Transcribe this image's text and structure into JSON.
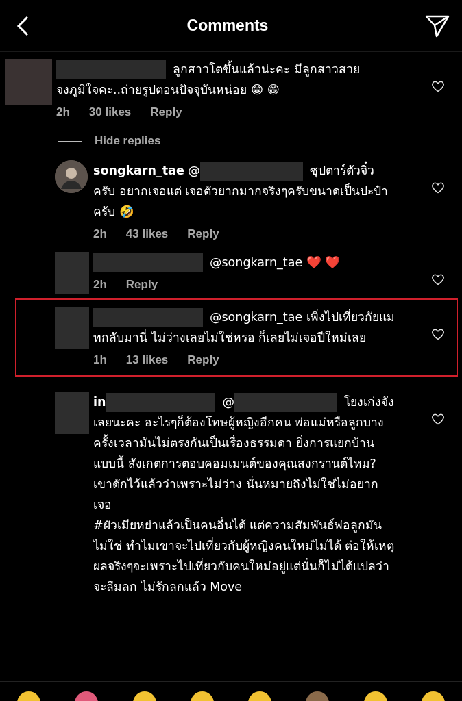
{
  "header": {
    "title": "Comments"
  },
  "comments": [
    {
      "kind": "comment",
      "text": "ลูกสาวโตขึ้นแล้วน่ะคะ มีลูกสาวสวยจงภูมิใจคะ..ถ่ายรูปตอนปัจจุบันหน่อย 😁 😁",
      "time": "2h",
      "likes": "30 likes",
      "reply": "Reply",
      "highlighted": false
    },
    {
      "kind": "toggle",
      "label": "Hide replies"
    },
    {
      "kind": "reply",
      "username": "songkarn_tae",
      "mention": "@",
      "text": "ซุปตาร์ตัวจิ๋วครับ อยากเจอแต่ เจอตัวยากมากจริงๆครับขนาดเป็นปะป๋าครับ 🤣",
      "time": "2h",
      "likes": "43 likes",
      "reply": "Reply",
      "highlighted": false
    },
    {
      "kind": "reply",
      "text": "@songkarn_tae ❤️ ❤️",
      "time": "2h",
      "reply": "Reply",
      "highlighted": false
    },
    {
      "kind": "reply",
      "text": "@songkarn_tae เพิ่งไปเที่ยวกัยแมทกลับมานี่ ไม่ว่างเลยไม่ใช่หรอ ก็เลยไม่เจอปีใหม่เลย",
      "time": "1h",
      "likes": "13 likes",
      "reply": "Reply",
      "highlighted": true
    },
    {
      "kind": "reply",
      "prefix": "in",
      "mention": "@",
      "text": "โยงเก่งจังเลยนะคะ อะไรๆก็ต้องโทษผู้หญิงอีกคน พ่อแม่หรือลูกบางครั้งเวลามันไม่ตรงกันเป็นเรื่องธรรมดา ยิ่งการแยกบ้านแบบนี้ สังเกตการตอบคอมเมนต์ของคุณสงกรานต์ไหม? เขาดักไว้แล้วว่าเพราะไม่ว่าง นั่นหมายถึงไม่ใช่ไม่อยากเจอ",
      "text2": "#ผัวเมียหย่าแล้วเป็นคนอื่นได้ แต่ความสัมพันธ์พ่อลูกมันไม่ใช่ ทำไมเขาจะไปเที่ยวกับผู้หญิงคนใหม่ไม่ได้ ต่อให้เหตุผลจริงๆจะเพราะไปเที่ยวกับคนใหม่อยู่แต่นั่นก็ไม่ได้แปลว่าจะลืมลก ไม่รักลกแล้ว Move",
      "highlighted": false
    }
  ]
}
